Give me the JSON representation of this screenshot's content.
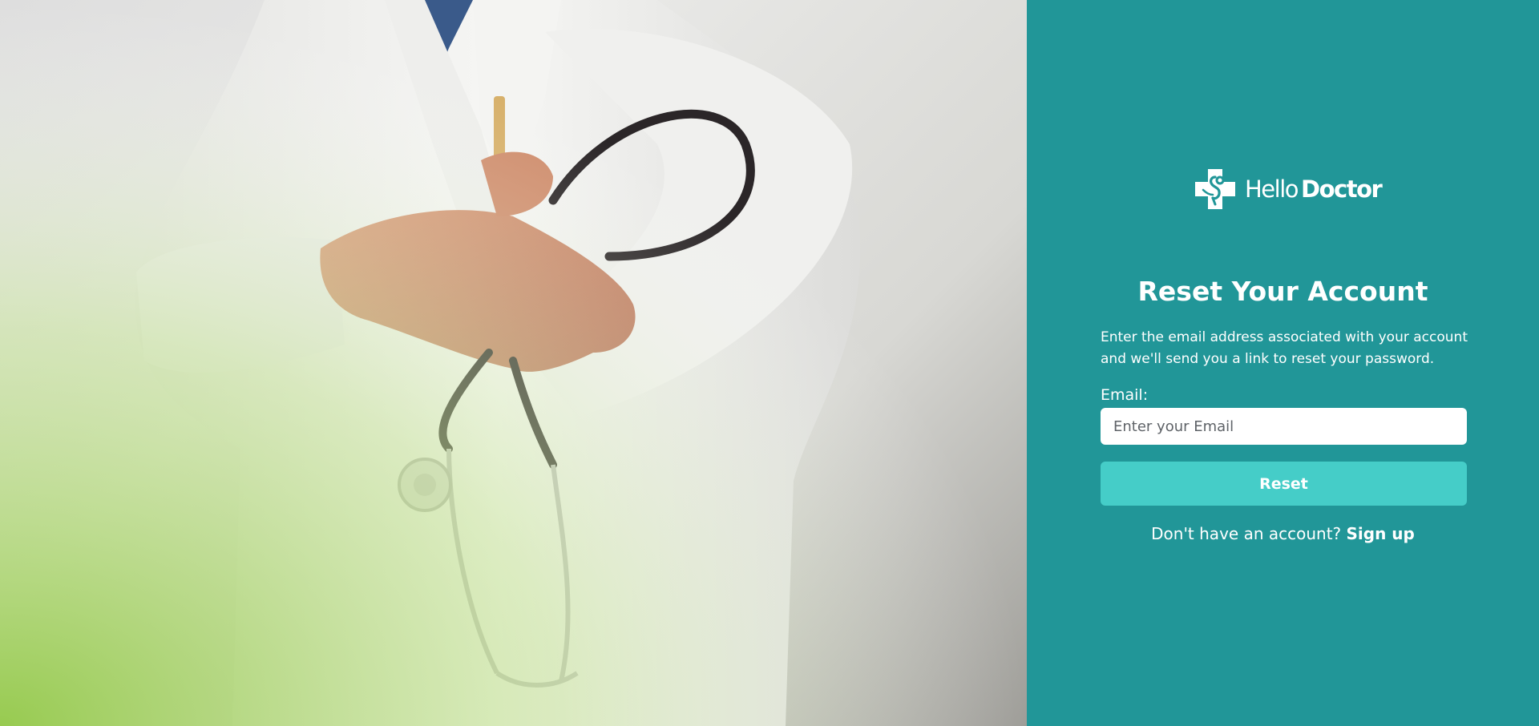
{
  "brand": {
    "name_light": "Hello",
    "name_bold": "Doctor"
  },
  "hero": {
    "image": "doctor-with-stethoscope-photo"
  },
  "reset_form": {
    "title": "Reset Your Account",
    "description": "Enter the email address associated with your account and we'll send you a link to reset your password.",
    "email_label": "Email:",
    "email_placeholder": "Enter your Email",
    "email_value": "",
    "submit_label": "Reset"
  },
  "signup": {
    "prompt": "Don't have an account?",
    "link_label": "Sign up"
  },
  "colors": {
    "panel_background": "#219698",
    "button_background": "#45cdc8",
    "hero_gradient_green": "#9ccf52",
    "text": "#ffffff"
  },
  "icons": {
    "logo": "medical-cross-stethoscope-icon"
  }
}
